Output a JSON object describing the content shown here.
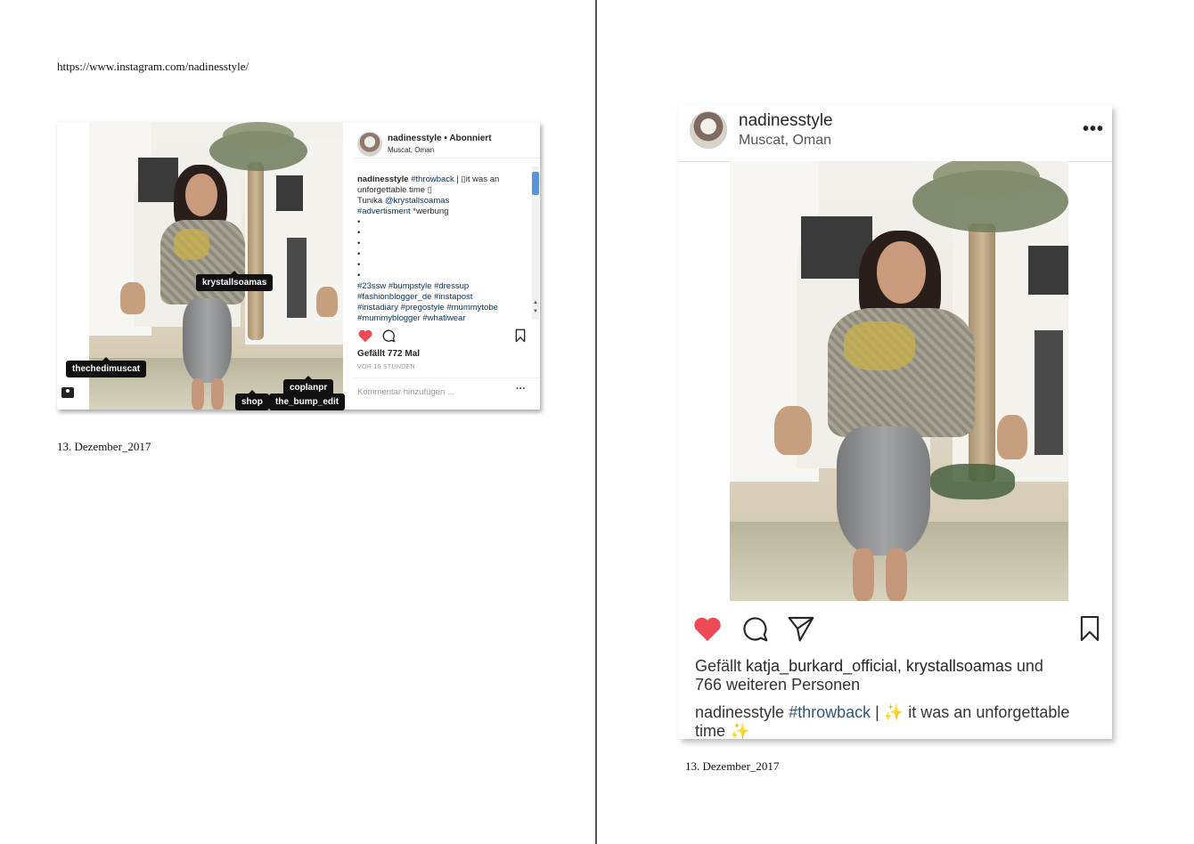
{
  "page": {
    "url": "https://www.instagram.com/nadinesstyle/",
    "date_left": "13. Dezember_2017",
    "date_right": "13. Dezember_2017"
  },
  "embed": {
    "username": "nadinesstyle",
    "follow_sep": "•",
    "follow_status": "Abonniert",
    "location": "Muscat, Oman",
    "tags": {
      "krystall": "krystallsoamas",
      "chedi": "thechedimuscat",
      "coplan": "coplanpr",
      "shop": "shop",
      "bump": "the_bump_edit"
    },
    "caption": {
      "username": "nadinesstyle",
      "hashtag1": "#throwback",
      "text1": " | ",
      "spark": "▯",
      "text2": "it was an unforgettable time ",
      "tunika_label": "Tunika ",
      "mention": "@krystallsoamas",
      "hashtag_ad": "#advertisment",
      "werbung": " *werbung",
      "dot": "•",
      "hashtags_line1": "#23ssw #bumpstyle #dressup",
      "hashtags_line2": "#fashionblogger_de #instapost",
      "hashtags_line3": "#instadiary #pregostyle #mummytobe",
      "hashtags_line4": "#mummyblogger #whatiwear"
    },
    "likes": "Gefällt 772 Mal",
    "time": "VOR 16 STUNDEN",
    "comment_placeholder": "Kommentar hinzufügen ...",
    "more": "···"
  },
  "post": {
    "username": "nadinesstyle",
    "location": "Muscat, Oman",
    "more": "•••",
    "likes_prefix": "Gefällt ",
    "liker1": "katja_burkard_official",
    "likes_comma": ", ",
    "liker2": "krystallsoamas",
    "likes_and": " und",
    "likes_rest": "766 weiteren Personen",
    "caption_username": "nadinesstyle",
    "caption_hashtag": "#throwback",
    "caption_pipe": " | ",
    "caption_spark": "✨",
    "caption_text": "it was an unforgettable",
    "caption_text2": "time "
  },
  "colors": {
    "heart": "#ed4956",
    "link": "#003569",
    "text": "#262626"
  },
  "icons": [
    "heart-icon",
    "comment-icon",
    "share-icon",
    "bookmark-icon",
    "user-tag-icon",
    "more-icon"
  ]
}
